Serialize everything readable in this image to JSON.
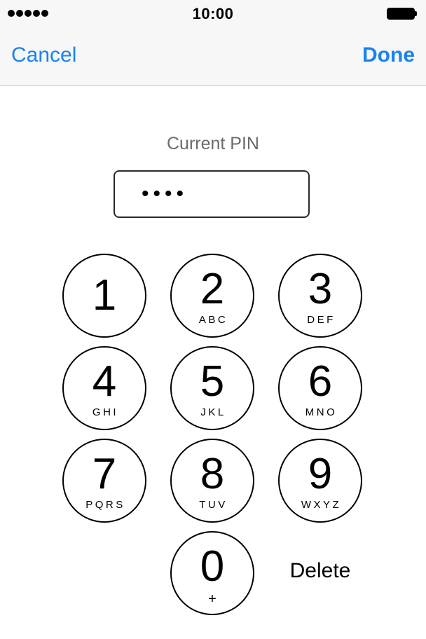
{
  "status_bar": {
    "time": "10:00",
    "signal_bars": 5,
    "battery_level": 1.0
  },
  "nav": {
    "cancel_label": "Cancel",
    "done_label": "Done"
  },
  "pin": {
    "label": "Current PIN",
    "masked_value": "••••"
  },
  "keypad": {
    "keys": [
      {
        "digit": "1",
        "letters": ""
      },
      {
        "digit": "2",
        "letters": "ABC"
      },
      {
        "digit": "3",
        "letters": "DEF"
      },
      {
        "digit": "4",
        "letters": "GHI"
      },
      {
        "digit": "5",
        "letters": "JKL"
      },
      {
        "digit": "6",
        "letters": "MNO"
      },
      {
        "digit": "7",
        "letters": "PQRS"
      },
      {
        "digit": "8",
        "letters": "TUV"
      },
      {
        "digit": "9",
        "letters": "WXYZ"
      },
      {
        "digit": "0",
        "letters": "+"
      }
    ],
    "delete_label": "Delete"
  },
  "colors": {
    "accent": "#1a82f0",
    "bar_background": "#f7f7f7",
    "label_gray": "#6b6b6b"
  }
}
